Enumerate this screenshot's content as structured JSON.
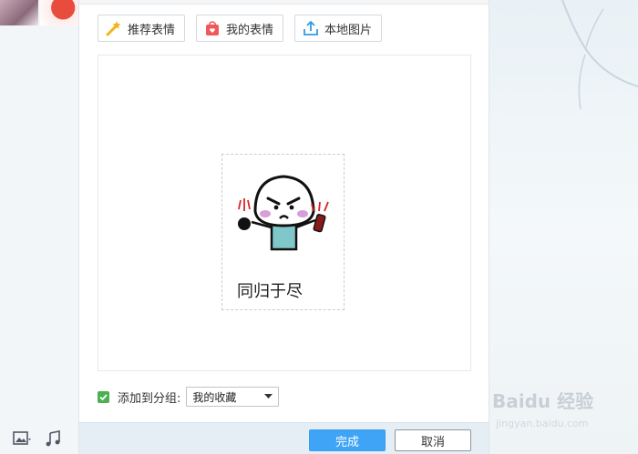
{
  "tabs": [
    {
      "label": "推荐表情",
      "icon": "magic-wand-icon"
    },
    {
      "label": "我的表情",
      "icon": "shopping-bag-icon"
    },
    {
      "label": "本地图片",
      "icon": "upload-icon"
    }
  ],
  "sticker": {
    "caption": "同归于尽"
  },
  "group": {
    "checked": true,
    "label": "添加到分组:",
    "selected": "我的收藏"
  },
  "buttons": {
    "ok": "完成",
    "cancel": "取消"
  },
  "watermark": {
    "text": "Baidu 经验",
    "sub": "jingyan.baidu.com"
  },
  "colors": {
    "primary_button": "#3fa4f6",
    "checkbox": "#4caf50",
    "footer_bg": "#e6eef5"
  }
}
